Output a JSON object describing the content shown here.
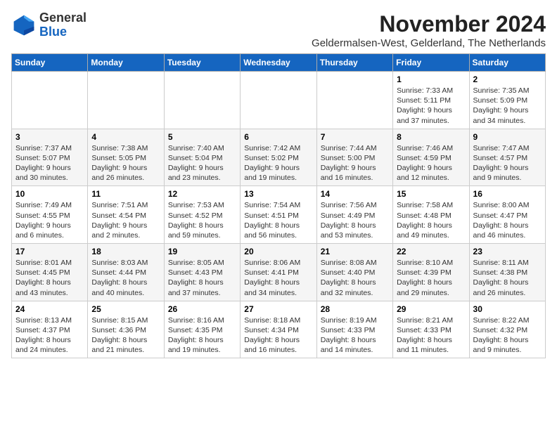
{
  "header": {
    "logo_line1": "General",
    "logo_line2": "Blue",
    "month_title": "November 2024",
    "subtitle": "Geldermalsen-West, Gelderland, The Netherlands"
  },
  "weekdays": [
    "Sunday",
    "Monday",
    "Tuesday",
    "Wednesday",
    "Thursday",
    "Friday",
    "Saturday"
  ],
  "weeks": [
    [
      {
        "day": "",
        "info": ""
      },
      {
        "day": "",
        "info": ""
      },
      {
        "day": "",
        "info": ""
      },
      {
        "day": "",
        "info": ""
      },
      {
        "day": "",
        "info": ""
      },
      {
        "day": "1",
        "info": "Sunrise: 7:33 AM\nSunset: 5:11 PM\nDaylight: 9 hours and 37 minutes."
      },
      {
        "day": "2",
        "info": "Sunrise: 7:35 AM\nSunset: 5:09 PM\nDaylight: 9 hours and 34 minutes."
      }
    ],
    [
      {
        "day": "3",
        "info": "Sunrise: 7:37 AM\nSunset: 5:07 PM\nDaylight: 9 hours and 30 minutes."
      },
      {
        "day": "4",
        "info": "Sunrise: 7:38 AM\nSunset: 5:05 PM\nDaylight: 9 hours and 26 minutes."
      },
      {
        "day": "5",
        "info": "Sunrise: 7:40 AM\nSunset: 5:04 PM\nDaylight: 9 hours and 23 minutes."
      },
      {
        "day": "6",
        "info": "Sunrise: 7:42 AM\nSunset: 5:02 PM\nDaylight: 9 hours and 19 minutes."
      },
      {
        "day": "7",
        "info": "Sunrise: 7:44 AM\nSunset: 5:00 PM\nDaylight: 9 hours and 16 minutes."
      },
      {
        "day": "8",
        "info": "Sunrise: 7:46 AM\nSunset: 4:59 PM\nDaylight: 9 hours and 12 minutes."
      },
      {
        "day": "9",
        "info": "Sunrise: 7:47 AM\nSunset: 4:57 PM\nDaylight: 9 hours and 9 minutes."
      }
    ],
    [
      {
        "day": "10",
        "info": "Sunrise: 7:49 AM\nSunset: 4:55 PM\nDaylight: 9 hours and 6 minutes."
      },
      {
        "day": "11",
        "info": "Sunrise: 7:51 AM\nSunset: 4:54 PM\nDaylight: 9 hours and 2 minutes."
      },
      {
        "day": "12",
        "info": "Sunrise: 7:53 AM\nSunset: 4:52 PM\nDaylight: 8 hours and 59 minutes."
      },
      {
        "day": "13",
        "info": "Sunrise: 7:54 AM\nSunset: 4:51 PM\nDaylight: 8 hours and 56 minutes."
      },
      {
        "day": "14",
        "info": "Sunrise: 7:56 AM\nSunset: 4:49 PM\nDaylight: 8 hours and 53 minutes."
      },
      {
        "day": "15",
        "info": "Sunrise: 7:58 AM\nSunset: 4:48 PM\nDaylight: 8 hours and 49 minutes."
      },
      {
        "day": "16",
        "info": "Sunrise: 8:00 AM\nSunset: 4:47 PM\nDaylight: 8 hours and 46 minutes."
      }
    ],
    [
      {
        "day": "17",
        "info": "Sunrise: 8:01 AM\nSunset: 4:45 PM\nDaylight: 8 hours and 43 minutes."
      },
      {
        "day": "18",
        "info": "Sunrise: 8:03 AM\nSunset: 4:44 PM\nDaylight: 8 hours and 40 minutes."
      },
      {
        "day": "19",
        "info": "Sunrise: 8:05 AM\nSunset: 4:43 PM\nDaylight: 8 hours and 37 minutes."
      },
      {
        "day": "20",
        "info": "Sunrise: 8:06 AM\nSunset: 4:41 PM\nDaylight: 8 hours and 34 minutes."
      },
      {
        "day": "21",
        "info": "Sunrise: 8:08 AM\nSunset: 4:40 PM\nDaylight: 8 hours and 32 minutes."
      },
      {
        "day": "22",
        "info": "Sunrise: 8:10 AM\nSunset: 4:39 PM\nDaylight: 8 hours and 29 minutes."
      },
      {
        "day": "23",
        "info": "Sunrise: 8:11 AM\nSunset: 4:38 PM\nDaylight: 8 hours and 26 minutes."
      }
    ],
    [
      {
        "day": "24",
        "info": "Sunrise: 8:13 AM\nSunset: 4:37 PM\nDaylight: 8 hours and 24 minutes."
      },
      {
        "day": "25",
        "info": "Sunrise: 8:15 AM\nSunset: 4:36 PM\nDaylight: 8 hours and 21 minutes."
      },
      {
        "day": "26",
        "info": "Sunrise: 8:16 AM\nSunset: 4:35 PM\nDaylight: 8 hours and 19 minutes."
      },
      {
        "day": "27",
        "info": "Sunrise: 8:18 AM\nSunset: 4:34 PM\nDaylight: 8 hours and 16 minutes."
      },
      {
        "day": "28",
        "info": "Sunrise: 8:19 AM\nSunset: 4:33 PM\nDaylight: 8 hours and 14 minutes."
      },
      {
        "day": "29",
        "info": "Sunrise: 8:21 AM\nSunset: 4:33 PM\nDaylight: 8 hours and 11 minutes."
      },
      {
        "day": "30",
        "info": "Sunrise: 8:22 AM\nSunset: 4:32 PM\nDaylight: 8 hours and 9 minutes."
      }
    ]
  ]
}
